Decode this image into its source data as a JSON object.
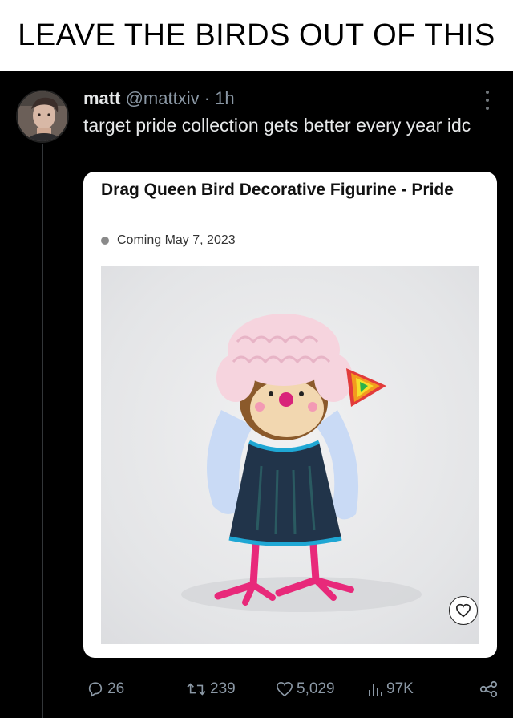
{
  "meme": {
    "caption": "LEAVE THE BIRDS OUT OF THIS"
  },
  "tweet": {
    "display_name": "matt",
    "handle": "@mattxiv",
    "separator": "·",
    "time": "1h",
    "text": "target pride collection gets better every year idc",
    "card": {
      "title": "Drag Queen Bird Decorative Figurine - Pride",
      "status": "Coming May 7, 2023"
    },
    "actions": {
      "replies": "26",
      "retweets": "239",
      "likes": "5,029",
      "views": "97K"
    }
  },
  "colors": {
    "background": "#000000",
    "text_primary": "#e7e9ea",
    "text_secondary": "#8b98a5",
    "card_background": "#ffffff"
  },
  "icons": [
    "more-icon",
    "reply-icon",
    "retweet-icon",
    "like-icon",
    "views-icon",
    "share-icon",
    "heart-outline-icon",
    "status-dot-icon"
  ]
}
